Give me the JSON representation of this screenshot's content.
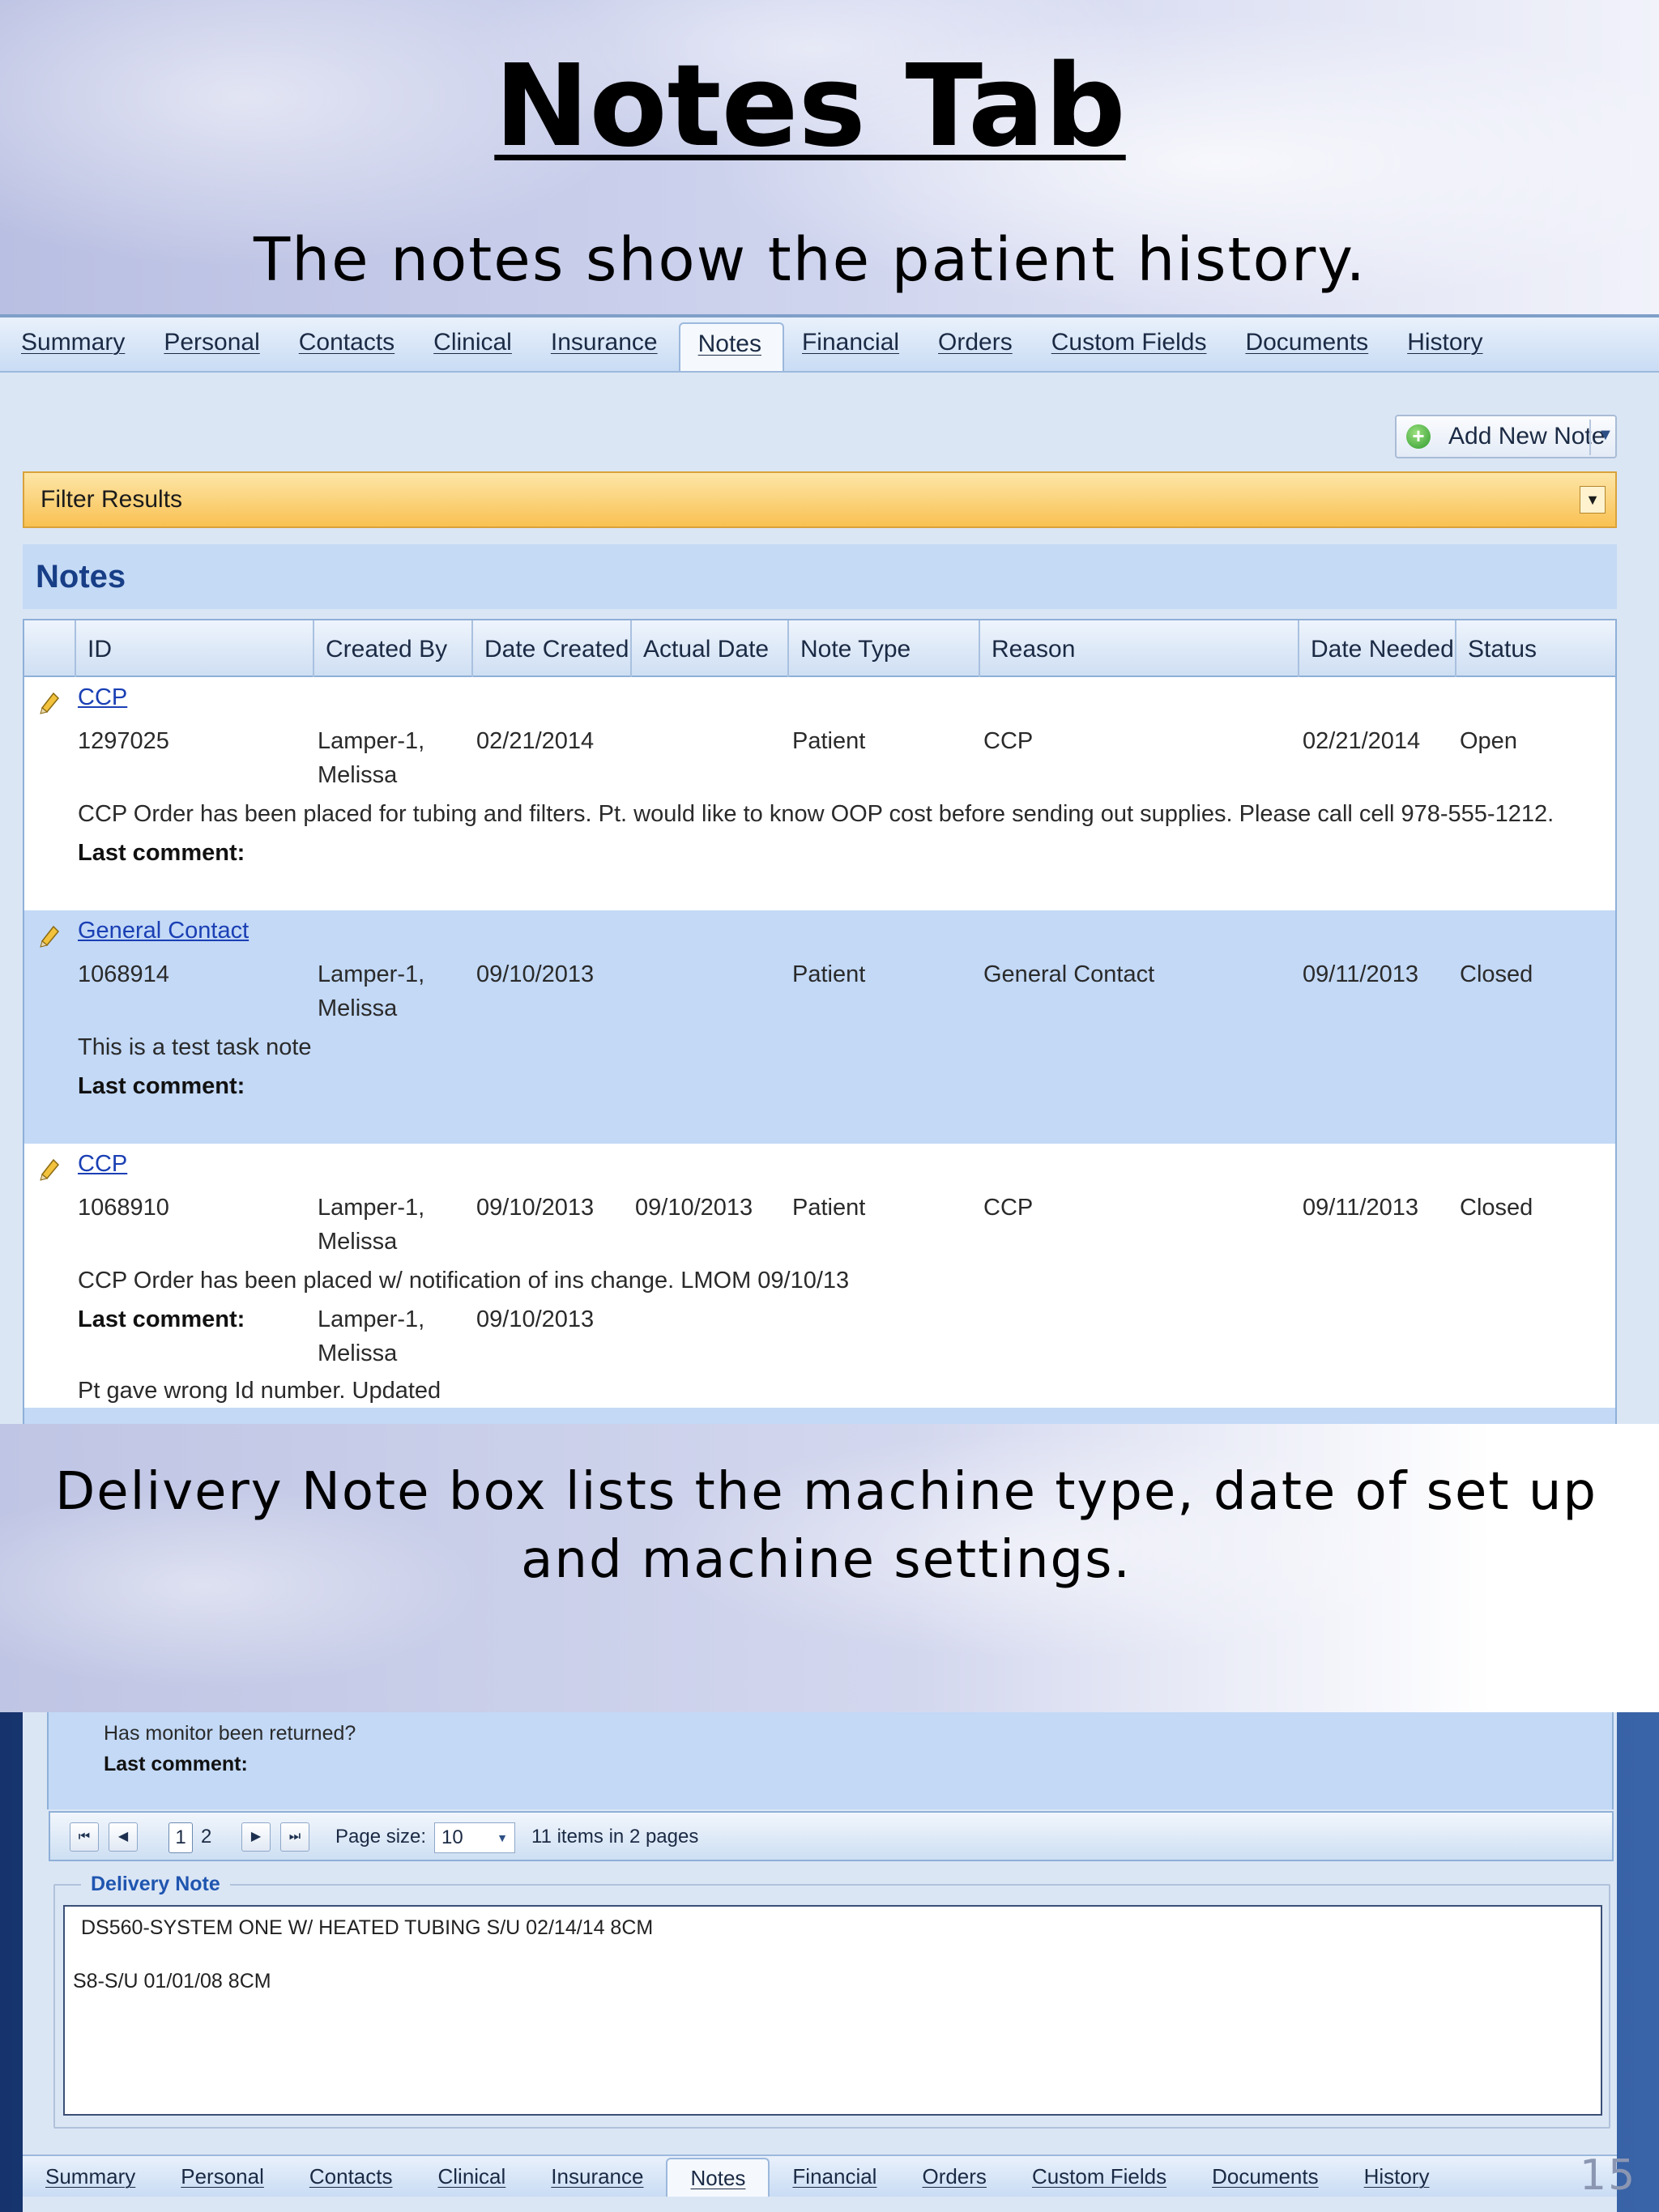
{
  "slide": {
    "title": "Notes Tab",
    "subtitle": "The notes show the patient history.",
    "caption": "Delivery Note box lists the machine type, date of set up and machine settings.",
    "slide_number": "15"
  },
  "tabs": [
    "Summary",
    "Personal",
    "Contacts",
    "Clinical",
    "Insurance",
    "Notes",
    "Financial",
    "Orders",
    "Custom Fields",
    "Documents",
    "History"
  ],
  "active_tab": "Notes",
  "toolbar": {
    "add_note_label": "Add New Note"
  },
  "filter": {
    "label": "Filter Results"
  },
  "notes_section": {
    "title": "Notes"
  },
  "grid": {
    "columns": [
      "ID",
      "Created By",
      "Date Created",
      "Actual Date",
      "Note Type",
      "Reason",
      "Date Needed",
      "Status"
    ],
    "rows": [
      {
        "title": "CCP",
        "id": "1297025",
        "created_by_1": "Lamper-1,",
        "created_by_2": "Melissa",
        "date_created": "02/21/2014",
        "actual_date": "",
        "note_type": "Patient",
        "reason": "CCP",
        "date_needed": "02/21/2014",
        "status": "Open",
        "text": "CCP Order has been placed for tubing and filters. Pt. would like to know OOP cost before sending out supplies. Please call cell 978-555-1212.",
        "last_comment_label": "Last comment:"
      },
      {
        "title": "General Contact",
        "id": "1068914",
        "created_by_1": "Lamper-1,",
        "created_by_2": "Melissa",
        "date_created": "09/10/2013",
        "actual_date": "",
        "note_type": "Patient",
        "reason": "General Contact",
        "date_needed": "09/11/2013",
        "status": "Closed",
        "text": "This is a test task note",
        "last_comment_label": "Last comment:"
      },
      {
        "title": "CCP",
        "id": "1068910",
        "created_by_1": "Lamper-1,",
        "created_by_2": "Melissa",
        "date_created": "09/10/2013",
        "actual_date": "09/10/2013",
        "note_type": "Patient",
        "reason": "CCP",
        "date_needed": "09/11/2013",
        "status": "Closed",
        "text": "CCP Order has been placed w/ notification of ins change. LMOM 09/10/13",
        "last_comment_label": "Last comment:",
        "comment_by_1": "Lamper-1,",
        "comment_by_2": "Melissa",
        "comment_date": "09/10/2013",
        "comment_text": "Pt gave wrong Id number. Updated"
      }
    ]
  },
  "lower_rows": {
    "text": "Has monitor been returned?",
    "last_comment_label": "Last comment:"
  },
  "pager": {
    "pages": [
      "1",
      "2"
    ],
    "current_page": "1",
    "page_size_label": "Page size:",
    "page_size_value": "10",
    "summary": "11 items in 2 pages"
  },
  "delivery_note": {
    "legend": "Delivery Note",
    "line1": "DS560-SYSTEM ONE W/ HEATED TUBING S/U 02/14/14 8CM",
    "line2": "S8-S/U 01/01/08 8CM"
  }
}
